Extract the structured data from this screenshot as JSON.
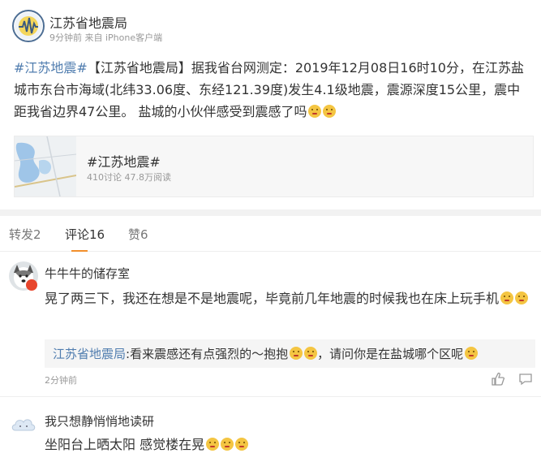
{
  "post": {
    "author": "江苏省地震局",
    "meta": "9分钟前 来自 iPhone客户端",
    "hashtag": "#江苏地震#",
    "text_main": "【江苏省地震局】据我省台网测定：2019年12月08日16时10分，在江苏盐城市东台市海域(北纬33.06度、东经121.39度)发生4.1级地震，震源深度15公里，震中距我省边界47公里。 盐城的小伙伴感受到震感了吗"
  },
  "topic_card": {
    "title": "#江苏地震#",
    "stats": "410讨论 47.8万阅读"
  },
  "tabs": [
    {
      "label": "转发2"
    },
    {
      "label": "评论16"
    },
    {
      "label": "赞6"
    }
  ],
  "comments": [
    {
      "name": "牛牛牛的储存室",
      "text": "晃了两三下，我还在想是不是地震呢，毕竟前几年地震的时候我也在床上玩手机",
      "reply_author": "江苏省地震局",
      "reply_text": ":看来震感还有点强烈的～抱抱",
      "reply_text2": "，请问你是在盐城哪个区呢",
      "time": "2分钟前"
    },
    {
      "name": "我只想静悄悄地读研",
      "text": "坐阳台上晒太阳 感觉楼在晃"
    }
  ],
  "icons": [
    "emoji-worried-icon",
    "emoji-cry-icon",
    "emoji-hug-icon",
    "emoji-laugh-cry-icon",
    "like-icon",
    "comment-icon"
  ],
  "colors": {
    "link": "#507daf",
    "accent": "#f28f2c",
    "meta": "#999999"
  }
}
